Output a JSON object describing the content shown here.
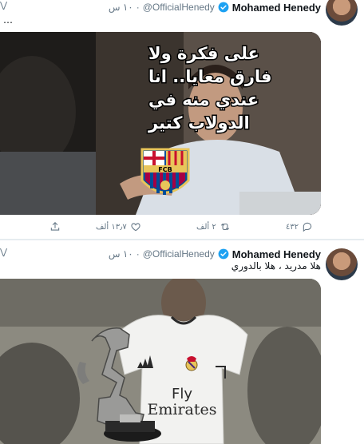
{
  "tweets": [
    {
      "name": "Mohamed Henedy",
      "handle": "@OfficialHenedy",
      "time": "١٠ س",
      "dot": "·",
      "text": "…",
      "more": "⋁",
      "meme": {
        "lines": [
          "على فكرة ولا",
          "فارق معايا.. انا",
          "عندي منه في",
          "الدولاب كتير"
        ],
        "badge": "FCB"
      },
      "actions": {
        "reply": "٤٣٢",
        "retweet": "٢ ألف",
        "like": "١٣٫٧ ألف"
      }
    },
    {
      "name": "Mohamed Henedy",
      "handle": "@OfficialHenedy",
      "time": "١٠ س",
      "dot": "·",
      "text": "هلا مدريد ، هلا بالدوري",
      "more": "⋁",
      "shirt": {
        "line1": "Fly",
        "line2": "Emirates"
      }
    }
  ],
  "colors": {
    "verified": "#1da1f2",
    "muted": "#657786",
    "divider": "#e6ecf0"
  }
}
